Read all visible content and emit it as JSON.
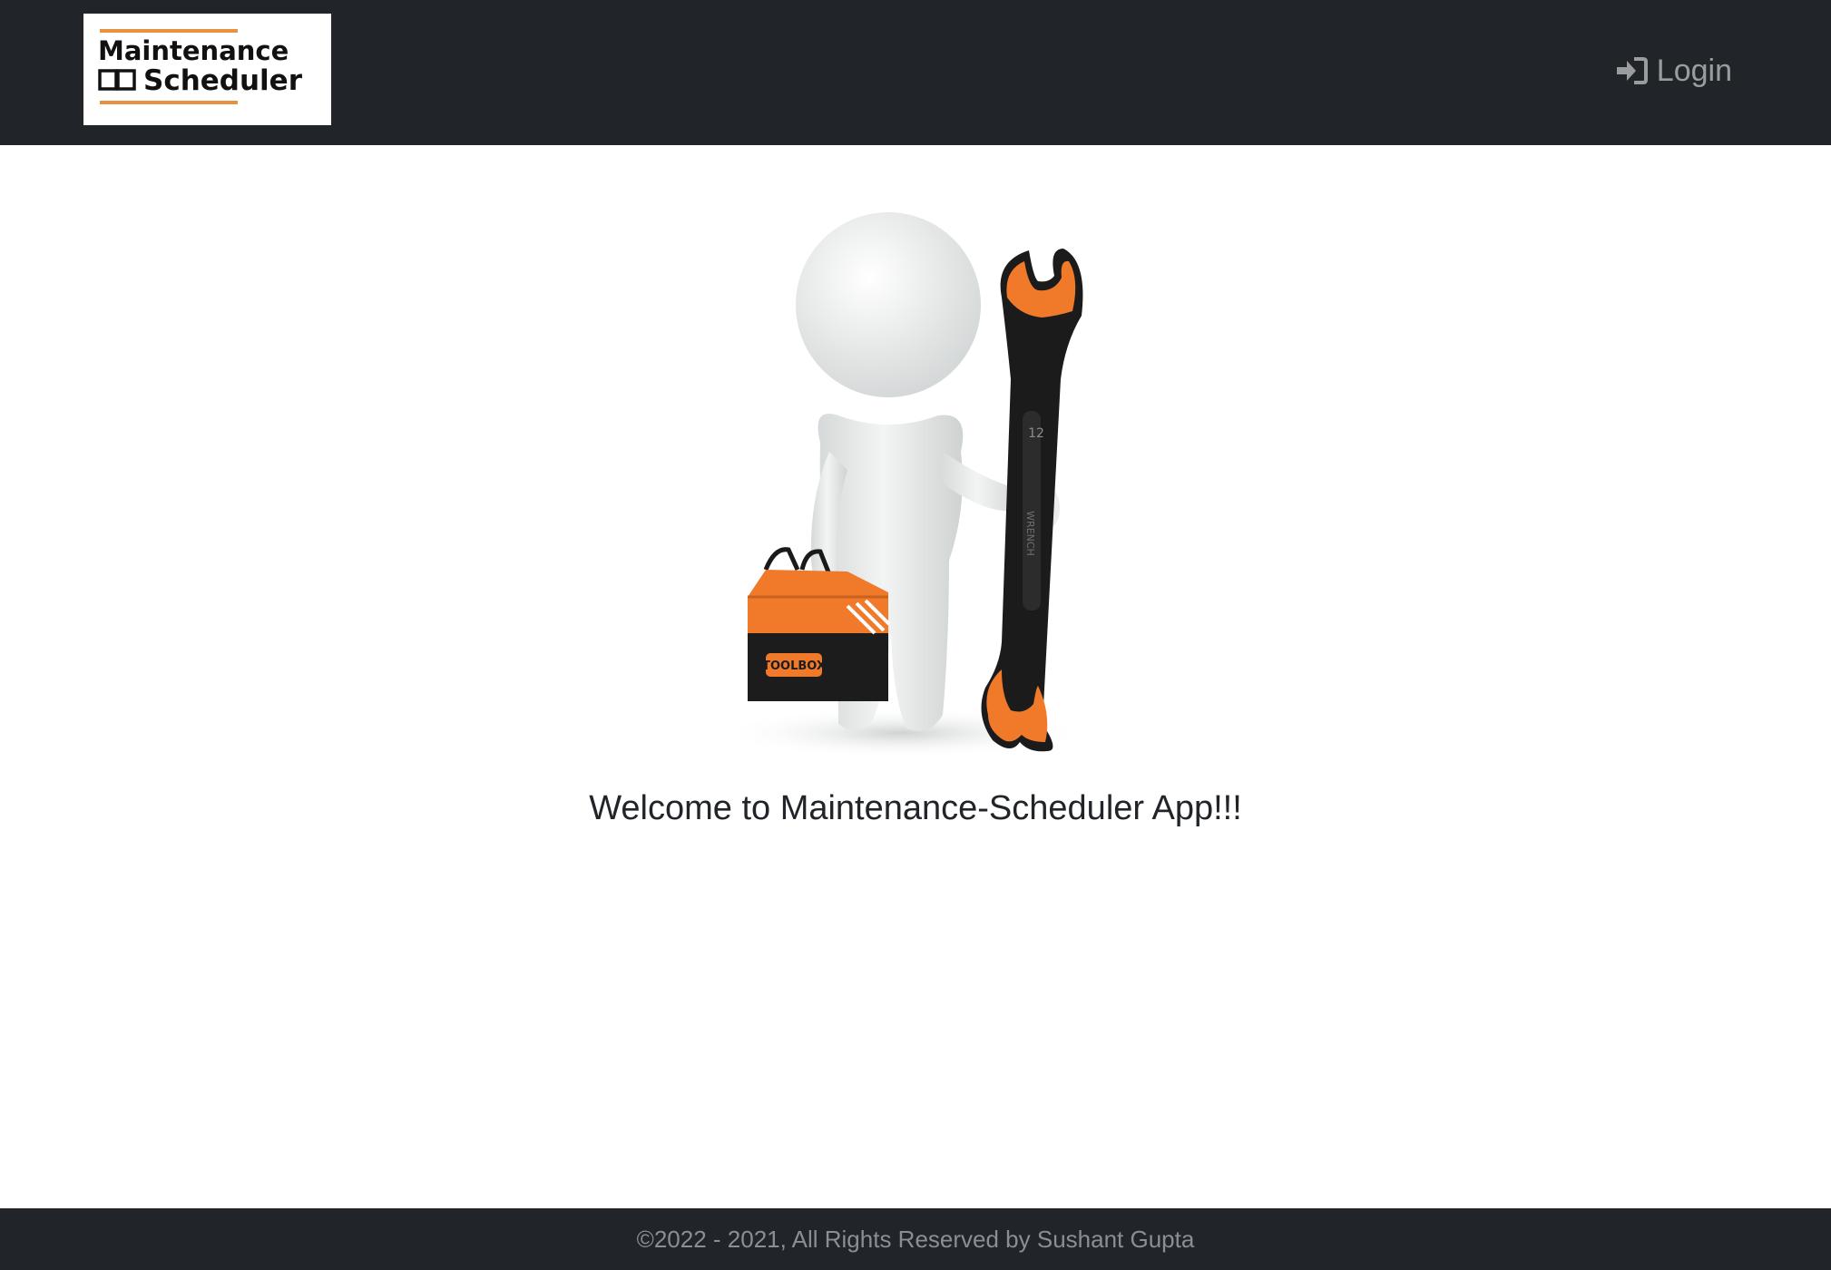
{
  "navbar": {
    "logo": {
      "line1": "Maintenance",
      "line2": "Scheduler"
    },
    "login_label": "Login"
  },
  "main": {
    "illustration": {
      "box_label": "TOOLBOX",
      "wrench_size": "12",
      "wrench_label": "WRENCH"
    },
    "welcome_text": "Welcome to Maintenance-Scheduler App!!!"
  },
  "footer": {
    "copyright": "©2022 - 2021, All Rights Reserved by Sushant Gupta"
  },
  "colors": {
    "nav_bg": "#212529",
    "accent_orange": "#f07a2a",
    "link_muted": "rgba(255,255,255,0.55)",
    "footer_text": "#8a8f95"
  }
}
